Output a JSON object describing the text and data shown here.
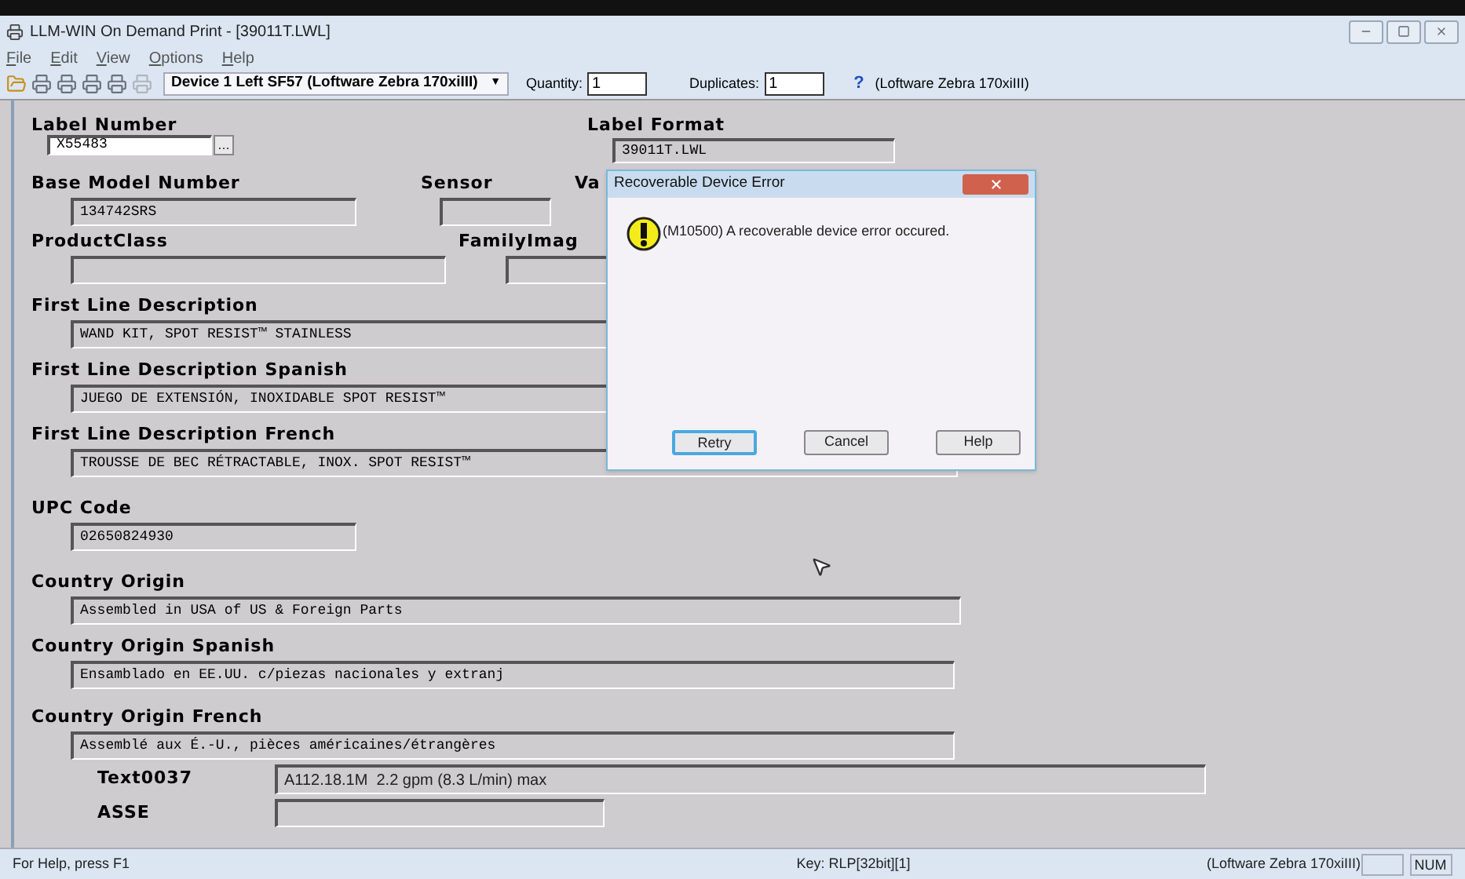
{
  "window": {
    "title": "LLM-WIN On Demand Print - [39011T.LWL]"
  },
  "menu": [
    {
      "label": "File"
    },
    {
      "label": "Edit"
    },
    {
      "label": "View"
    },
    {
      "label": "Options"
    },
    {
      "label": "Help"
    }
  ],
  "toolbar": {
    "device": "Device 1 Left SF57 (Loftware Zebra 170xiIII)",
    "quantity_label": "Quantity:",
    "quantity": "1",
    "duplicates_label": "Duplicates:",
    "duplicates": "1",
    "help_glyph": "?",
    "dropdown_glyph": "▼",
    "browse_glyph": "…",
    "printer": "(Loftware Zebra 170xiIII)"
  },
  "form": {
    "fields": [
      {
        "label": "Label Number",
        "value": "X55483"
      },
      {
        "label": "Label Format",
        "value": "39011T.LWL"
      },
      {
        "label": "Base Model Number",
        "value": "134742SRS"
      },
      {
        "label": "Sensor"
      },
      {
        "label": "Va"
      },
      {
        "label": "ProductClass"
      },
      {
        "label": "FamilyImag"
      },
      {
        "label": "First Line Description",
        "value": "WAND KIT, SPOT RESIST™ STAINLESS"
      },
      {
        "label": "First Line Description Spanish",
        "value": "JUEGO DE EXTENSIÓN, INOXIDABLE SPOT RESIST™"
      },
      {
        "label": "First Line Description French",
        "value": "TROUSSE DE BEC RÉTRACTABLE, INOX. SPOT RESIST™"
      },
      {
        "label": "UPC Code",
        "value": "02650824930"
      },
      {
        "label": "Country Origin",
        "value": "Assembled in USA of US & Foreign Parts"
      },
      {
        "label": "Country Origin Spanish",
        "value": "Ensamblado en EE.UU. c/piezas nacionales y extranj"
      },
      {
        "label": "Country Origin French",
        "value": "Assemblé aux É.-U., pièces américaines/étrangères"
      },
      {
        "label": "Text0037",
        "value": "A112.18.1M  2.2 gpm (8.3 L/min) max"
      },
      {
        "label": "ASSE"
      }
    ]
  },
  "dialog": {
    "title": "Recoverable Device Error",
    "message": "(M10500) A recoverable device error occured.",
    "buttons": [
      {
        "label": "Retry",
        "default": true
      },
      {
        "label": "Cancel",
        "default": false
      },
      {
        "label": "Help",
        "default": false
      }
    ]
  },
  "status_bar": {
    "help": "For Help, press F1",
    "key": "Key: RLP[32bit][1]",
    "printer": "(Loftware Zebra 170xiIII)",
    "num": "NUM"
  }
}
